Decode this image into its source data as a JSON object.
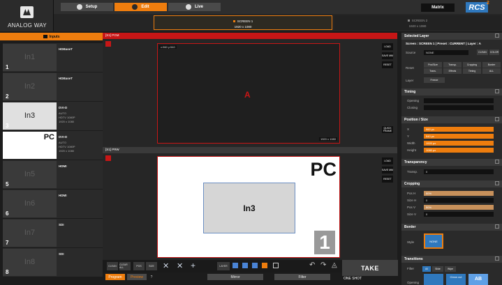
{
  "logo": {
    "text": "ANALOG WAY"
  },
  "tabs": {
    "setup": "Setup",
    "edit": "Edit",
    "live": "Live"
  },
  "header": {
    "matrix": "Matrix",
    "rcs": "RCS"
  },
  "screens": [
    {
      "name": "SCREEN 1",
      "res": "1920 x 1080"
    },
    {
      "name": "SCREEN 2",
      "res": "1920 x 1080"
    }
  ],
  "inputs_title": "Inputs",
  "inputs": [
    {
      "num": "1",
      "thumb": "In1",
      "name": "HDBaseT",
      "info": ""
    },
    {
      "num": "2",
      "thumb": "In2",
      "name": "HDBaseT",
      "info": ""
    },
    {
      "num": "3",
      "thumb": "In3",
      "name": "DVI-D",
      "info": "AUTO\nHDTV 1080P\n1920 x 1080"
    },
    {
      "num": "4",
      "thumb": "PC",
      "name": "DVI-D",
      "info": "AUTO\nHDTV 1080P\n1920 x 1080"
    },
    {
      "num": "5",
      "thumb": "In5",
      "name": "HDMI",
      "info": ""
    },
    {
      "num": "6",
      "thumb": "In6",
      "name": "HDMI",
      "info": ""
    },
    {
      "num": "7",
      "thumb": "In7",
      "name": "SDI",
      "info": ""
    },
    {
      "num": "8",
      "thumb": "In8",
      "name": "SDI",
      "info": ""
    }
  ],
  "program": {
    "title": "[S1] PGM",
    "coords": "x:960 y:540",
    "layer": "A",
    "res": "1920 x 1080"
  },
  "preview": {
    "title": "[S1] PRW",
    "pc": "PC",
    "in3": "In3",
    "one": "1"
  },
  "side_buttons": [
    "LOAD",
    "SAVE MM",
    "RESET"
  ],
  "quick_frame": "QUICK FRAME",
  "toolbar": {
    "clean": "CLEAN",
    "clear_all": "CLEAR ALL",
    "pos": "POS",
    "size": "SIZE",
    "layer": "LAYER"
  },
  "bottom": {
    "program": "Program",
    "preview": "Preview",
    "mirror": "Mirror",
    "filter": "Filter",
    "take": "TAKE",
    "one_shot": "ONE SHOT"
  },
  "right": {
    "selected_layer": "Selected Layer",
    "layer_info": "Screen : SCREEN 1 | Preset : CURRENT | Layer : A",
    "source_lbl": "Source",
    "source_val": "NONE",
    "reset_lbl": "Reset",
    "reset_btns": [
      "Pos/Size",
      "Transp.",
      "Cropping",
      "Border",
      "Trans.",
      "Effects",
      "Timing",
      "ALL"
    ],
    "layer_lbl": "Layer",
    "freeze": "Freeze",
    "timing": "Timing",
    "opening": "Opening",
    "closing": "Closing",
    "pos_size": "Position / Size",
    "x_lbl": "X",
    "x_val": "960 px",
    "y_lbl": "Y",
    "y_val": "540 px",
    "w_lbl": "Width",
    "w_val": "1920 px",
    "h_lbl": "Height",
    "h_val": "1080 px",
    "transparency": "Transparency",
    "transp_lbl": "Transp.",
    "transp_val": "0",
    "cropping": "Cropping",
    "posh_lbl": "Pos H",
    "posh_val": "50%",
    "sizeh_lbl": "Size H",
    "sizeh_val": "0",
    "posv_lbl": "Pos V",
    "posv_val": "50%",
    "sizev_lbl": "Size V",
    "sizev_val": "0",
    "border": "Border",
    "style_lbl": "Style",
    "style_val": "NONE",
    "transitions": "Transitions",
    "filter_lbl": "Filter",
    "filter_opts": [
      "All",
      "Slide",
      "Wipe"
    ],
    "open_lbl": "Opening",
    "clean_cut": "Clean cut",
    "ab": "AB"
  }
}
